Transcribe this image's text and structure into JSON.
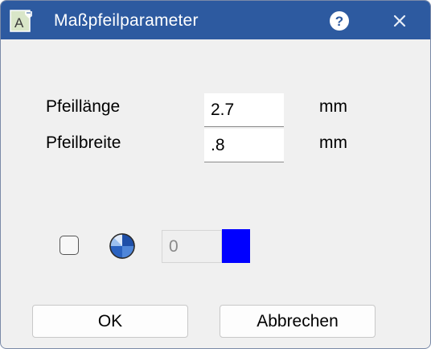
{
  "window": {
    "title": "Maßpfeilparameter",
    "titlebar_color": "#2d5aa0",
    "icons": {
      "app": "app-document-icon",
      "help": "help-icon",
      "close": "close-icon"
    }
  },
  "form": {
    "arrow_length_label": "Pfeillänge",
    "arrow_length_value": "2.7",
    "arrow_length_unit": "mm",
    "arrow_width_label": "Pfeilbreite",
    "arrow_width_value": ".8",
    "arrow_width_unit": "mm"
  },
  "color": {
    "use_color_checked": false,
    "wheel_icon": "color-wheel-icon",
    "index_value": "0",
    "swatch_color": "#0000ff"
  },
  "buttons": {
    "ok_label": "OK",
    "cancel_label": "Abbrechen"
  }
}
